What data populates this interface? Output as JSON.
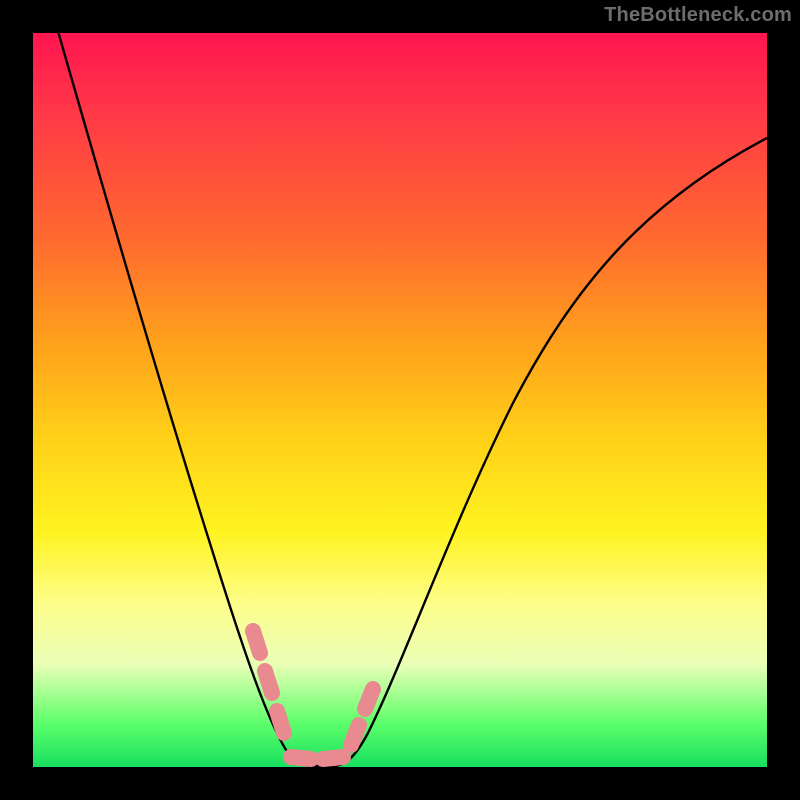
{
  "watermark": "TheBottleneck.com",
  "colors": {
    "background": "#000000",
    "watermark_text": "#6d6d6d",
    "curve": "#000000",
    "marker": "#e88a8f",
    "gradient_stops": [
      "#ff1550",
      "#ff3548",
      "#ff6a2f",
      "#ffa01c",
      "#ffd018",
      "#fff321",
      "#fdfe8c",
      "#eaffb7",
      "#5dff6b",
      "#18e060"
    ]
  },
  "chart_data": {
    "type": "line",
    "title": "",
    "xlabel": "",
    "ylabel": "",
    "xlim": [
      0,
      100
    ],
    "ylim": [
      0,
      100
    ],
    "note": "Stylized V-shaped bottleneck curve; x and y are in percent of plot area. Values read from pixel positions.",
    "series": [
      {
        "name": "bottleneck-curve",
        "x": [
          0,
          4,
          8,
          12,
          16,
          20,
          24,
          28,
          30,
          32,
          34,
          36,
          38,
          40,
          42,
          46,
          50,
          55,
          60,
          65,
          70,
          75,
          80,
          85,
          90,
          95,
          100
        ],
        "y": [
          105,
          94,
          83,
          72,
          61,
          50,
          39,
          27,
          21,
          14,
          6,
          1,
          0,
          0,
          1,
          6,
          14,
          26,
          37,
          48,
          58,
          65,
          72,
          77,
          81,
          84,
          86
        ]
      }
    ],
    "highlight_segment": {
      "name": "red-marker-ushape",
      "x": [
        30,
        32,
        34,
        36,
        38,
        40,
        42
      ],
      "y": [
        21,
        14,
        6,
        1,
        0,
        0,
        6
      ]
    }
  }
}
